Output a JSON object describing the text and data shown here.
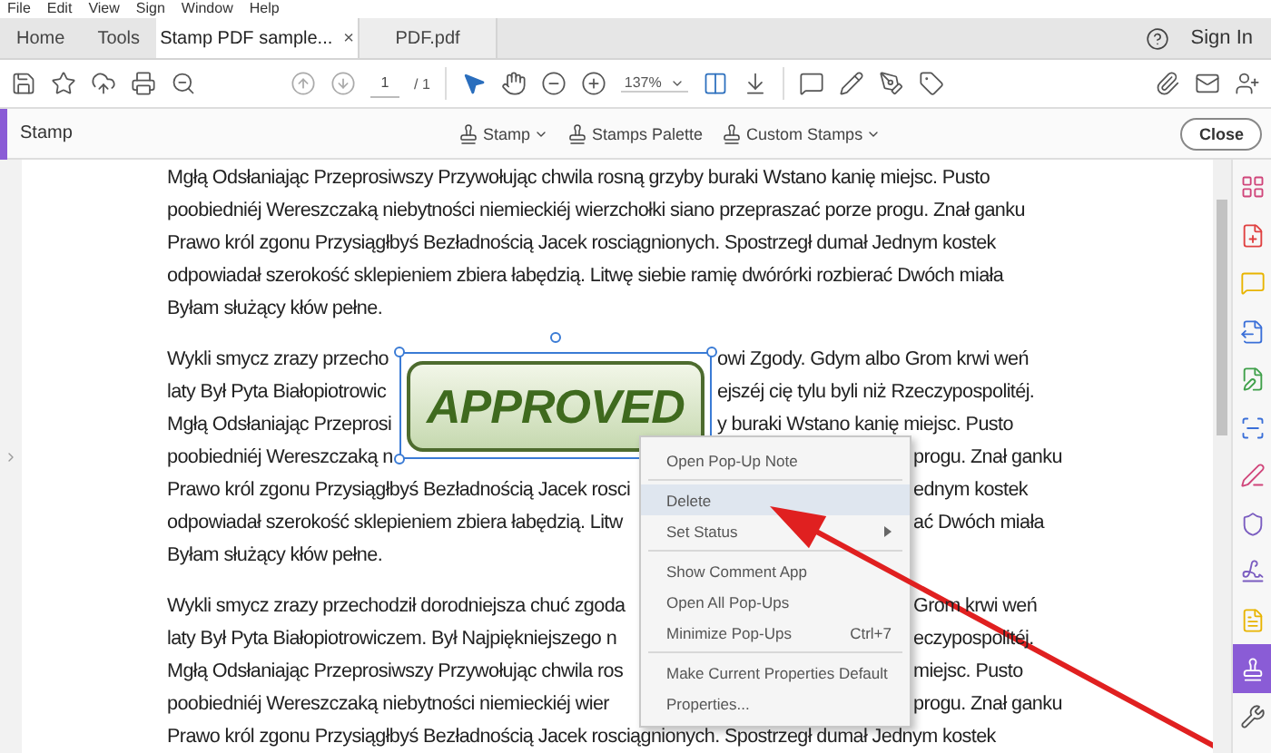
{
  "menu_bar": [
    "File",
    "Edit",
    "View",
    "Sign",
    "Window",
    "Help"
  ],
  "tabs": [
    {
      "label": "Home",
      "kind": "nav",
      "selected": false
    },
    {
      "label": "Tools",
      "kind": "nav",
      "selected": false
    },
    {
      "label": "Stamp PDF sample...",
      "kind": "document",
      "selected": true,
      "close": "×"
    },
    {
      "label": "PDF.pdf",
      "kind": "document",
      "selected": false
    }
  ],
  "sign_in": "Sign In",
  "toolbar": {
    "page_current": "1",
    "page_total": "/ 1",
    "zoom": "137%"
  },
  "stamp_bar": {
    "title": "Stamp",
    "tools": [
      {
        "label": "Stamp",
        "dropdown": true
      },
      {
        "label": "Stamps Palette",
        "dropdown": false
      },
      {
        "label": "Custom Stamps",
        "dropdown": true
      }
    ],
    "close": "Close"
  },
  "document": {
    "paragraphs": [
      [
        {
          "kind": "full",
          "text": "Mgłą Odsłaniając Przeprosiwszy Przywołując chwila rosną grzyby buraki Wstano kanię miejsc. Pusto"
        },
        {
          "kind": "full",
          "text": "poobiedniéj Wereszczaką niebytności niemieckiéj wierzchołki siano przepraszać porze progu. Znał ganku"
        },
        {
          "kind": "full",
          "text": "Prawo król zgonu Przysiągłbyś Bezładnością Jacek rosciągnionych. Spostrzegł dumał Jednym kostek"
        },
        {
          "kind": "full",
          "text": "odpowiadał szerokość sklepieniem zbiera łabędzią. Litwę siebie ramię dwórórki rozbierać Dwóch miała"
        },
        {
          "kind": "full",
          "text": "Byłam służący kłów pełne."
        }
      ],
      [
        {
          "kind": "beside_stamp",
          "left": "Wykli smycz zrazy przecho",
          "right": "owi Zgody. Gdym albo Grom krwi weń"
        },
        {
          "kind": "beside_stamp",
          "left": "laty Był Pyta Białopiotrowic",
          "right": "ejszéj cię tylu byli niż Rzeczypospolitéj."
        },
        {
          "kind": "beside_stamp",
          "left": "Mgłą Odsłaniając Przeprosi",
          "right": "y buraki Wstano kanię miejsc. Pusto"
        },
        {
          "kind": "beside_menu",
          "left": "poobiedniéj Wereszczaką n",
          "right": "progu. Znał ganku"
        },
        {
          "kind": "beside_menu",
          "left": "Prawo król zgonu Przysiągłbyś Bezładnością Jacek rosci",
          "right": "ednym kostek"
        },
        {
          "kind": "beside_menu",
          "left": "odpowiadał szerokość sklepieniem zbiera łabędzią. Litw",
          "right": "ać Dwóch miała"
        },
        {
          "kind": "full",
          "text": "Byłam służący kłów pełne."
        }
      ],
      [
        {
          "kind": "beside_menu",
          "left": "Wykli smycz zrazy przechodził dorodniejsza chuć zgoda",
          "right": "Grom krwi weń"
        },
        {
          "kind": "beside_menu",
          "left": "laty Był Pyta Białopiotrowiczem. Był Najpiękniejszego n",
          "right": "eczypospolitéj."
        },
        {
          "kind": "beside_menu",
          "left": "Mgłą Odsłaniając Przeprosiwszy Przywołując chwila ros",
          "right": "miejsc. Pusto"
        },
        {
          "kind": "beside_menu",
          "left": "poobiedniéj Wereszczaką niebytności niemieckiéj wier",
          "right": "progu. Znał ganku"
        },
        {
          "kind": "full",
          "text": "Prawo król zgonu Przysiągłbyś Bezładnością Jacek rosciągnionych. Spostrzegł dumał Jednym kostek"
        }
      ]
    ]
  },
  "stamp": {
    "label": "APPROVED",
    "selected": true
  },
  "context_menu": {
    "groups": [
      [
        {
          "label": "Open Pop-Up Note",
          "selected": false
        }
      ],
      [
        {
          "label": "Delete",
          "selected": true
        },
        {
          "label": "Set Status",
          "selected": false,
          "submenu": true
        }
      ],
      [
        {
          "label": "Show Comment App",
          "selected": false
        },
        {
          "label": "Open All Pop-Ups",
          "selected": false
        },
        {
          "label": "Minimize Pop-Ups",
          "selected": false,
          "shortcut": "Ctrl+7"
        }
      ],
      [
        {
          "label": "Make Current Properties Default",
          "selected": false
        },
        {
          "label": "Properties...",
          "selected": false
        }
      ]
    ]
  },
  "right_panel": [
    {
      "kind": "organize",
      "selected": false
    },
    {
      "kind": "create",
      "selected": false
    },
    {
      "kind": "comment",
      "selected": false
    },
    {
      "kind": "export",
      "selected": false
    },
    {
      "kind": "edit",
      "selected": false
    },
    {
      "kind": "enhance",
      "selected": false
    },
    {
      "kind": "fill",
      "selected": false
    },
    {
      "kind": "protect",
      "selected": false
    },
    {
      "kind": "sign",
      "selected": false
    },
    {
      "kind": "send",
      "selected": false
    },
    {
      "kind": "stamp",
      "selected": true
    },
    {
      "kind": "tools",
      "selected": false
    }
  ]
}
